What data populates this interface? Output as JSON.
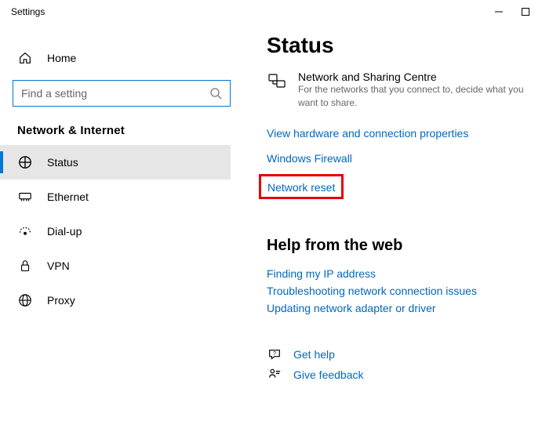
{
  "window": {
    "title": "Settings"
  },
  "sidebar": {
    "home": "Home",
    "search_placeholder": "Find a setting",
    "heading": "Network & Internet",
    "items": {
      "status": "Status",
      "ethernet": "Ethernet",
      "dialup": "Dial-up",
      "vpn": "VPN",
      "proxy": "Proxy"
    }
  },
  "content": {
    "heading": "Status",
    "sharing": {
      "title": "Network and Sharing Centre",
      "desc": "For the networks that you connect to, decide what you want to share."
    },
    "links": {
      "hwprops": "View hardware and connection properties",
      "firewall": "Windows Firewall",
      "reset": "Network reset"
    },
    "help_heading": "Help from the web",
    "help_links": {
      "ip": "Finding my IP address",
      "troubleshoot": "Troubleshooting network connection issues",
      "adapter": "Updating network adapter or driver"
    },
    "footer": {
      "gethelp": "Get help",
      "feedback": "Give feedback"
    }
  }
}
